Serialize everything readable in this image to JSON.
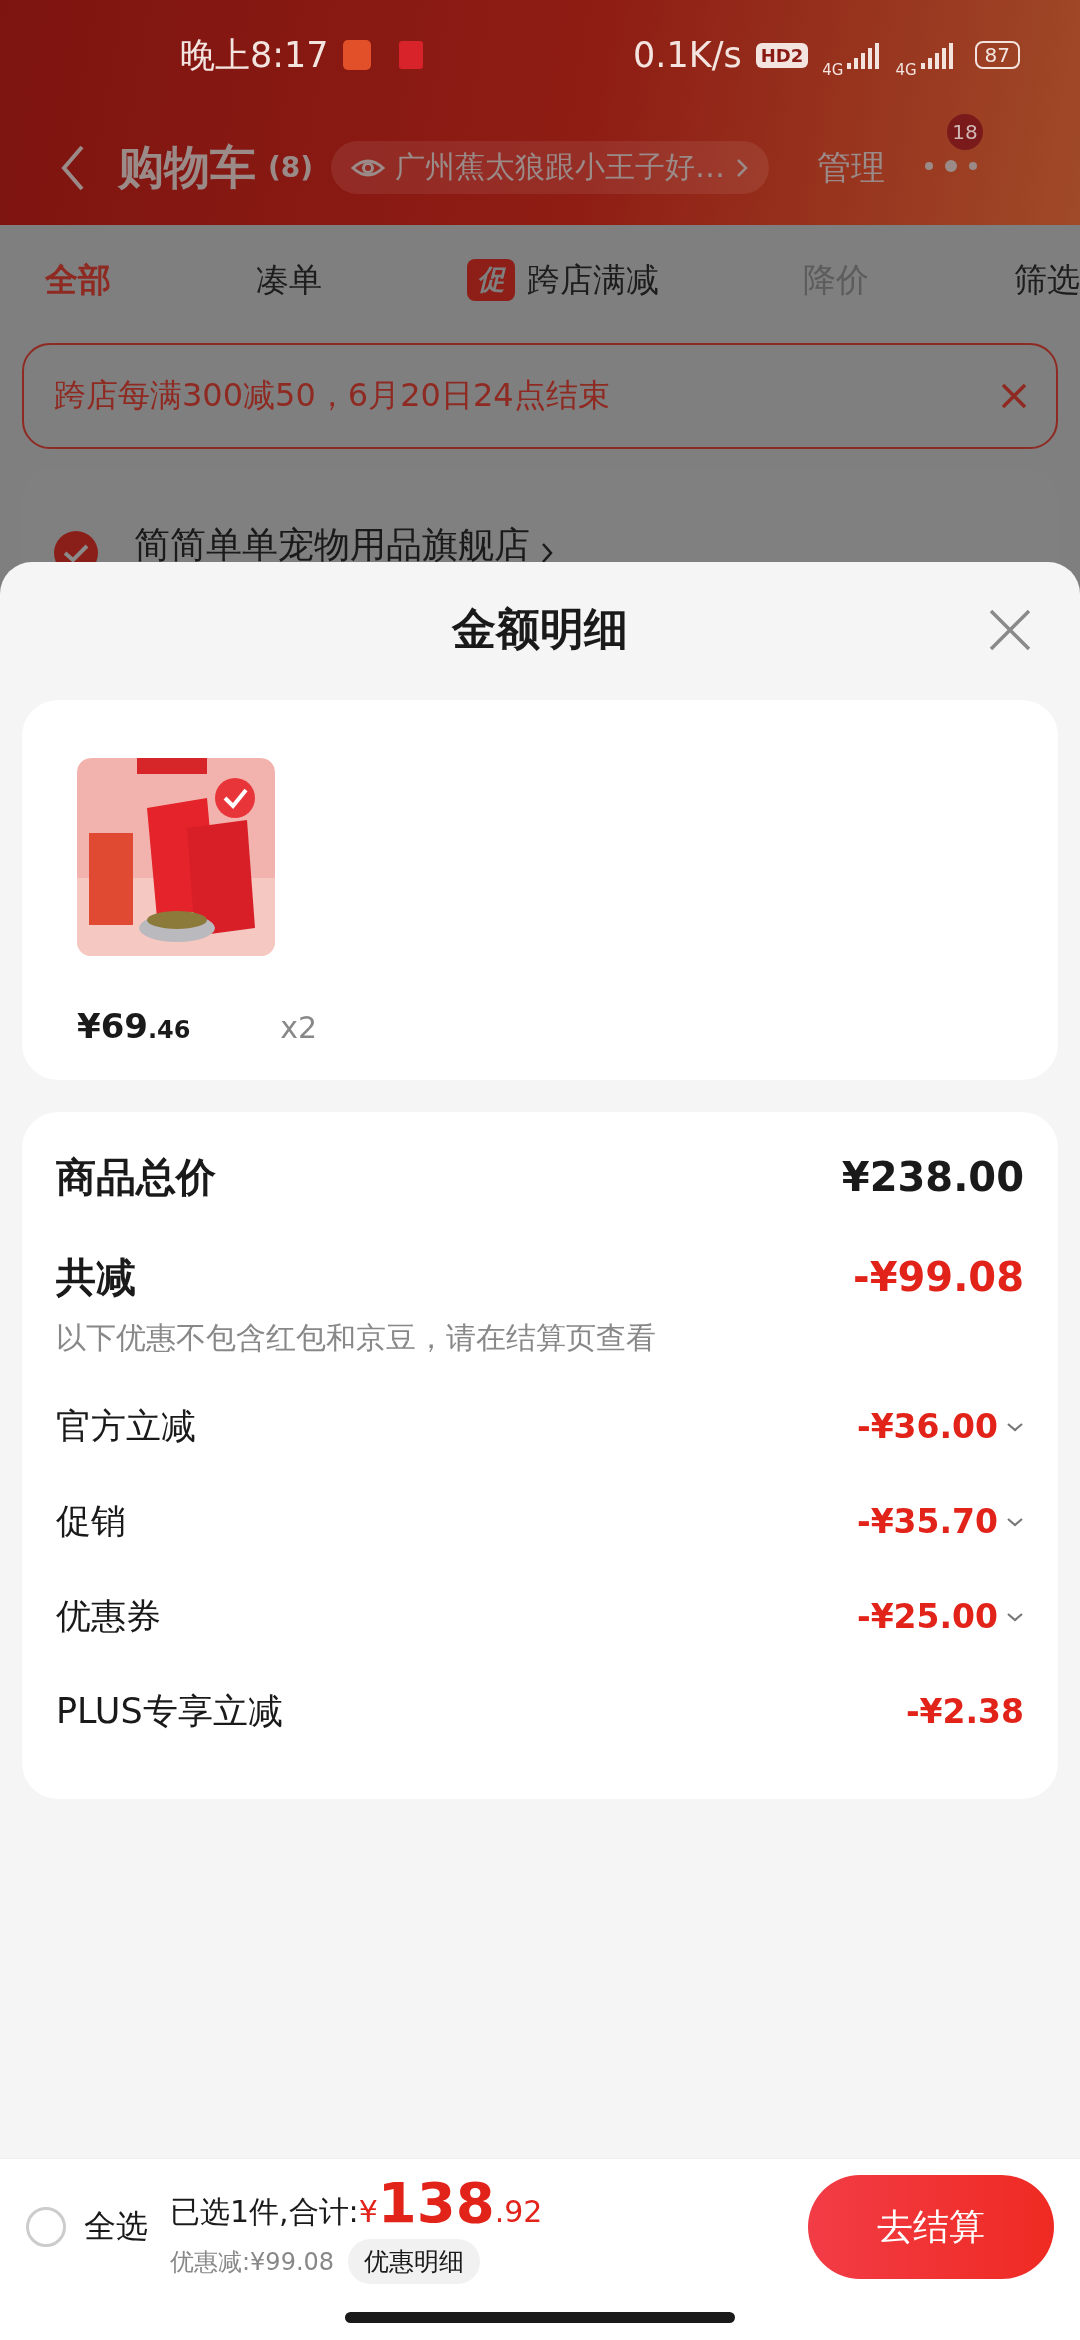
{
  "status_bar": {
    "time": "晚上8:17",
    "speed": "0.1K/s",
    "hd": "HD2",
    "networks": [
      "4G",
      "4G"
    ],
    "battery": "87"
  },
  "header": {
    "title": "购物车",
    "count": "(8)",
    "location": "广州蕉太狼跟小王子好…",
    "manage": "管理",
    "badge": "18"
  },
  "tabs": [
    {
      "label": "全部",
      "selected": true,
      "disabled": false,
      "kind": "text"
    },
    {
      "label": "凑单",
      "selected": false,
      "disabled": false,
      "kind": "text"
    },
    {
      "label": "跨店满减",
      "selected": false,
      "disabled": false,
      "kind": "promo",
      "tag": "促"
    },
    {
      "label": "降价",
      "selected": false,
      "disabled": true,
      "kind": "text"
    },
    {
      "label": "筛选",
      "selected": false,
      "disabled": false,
      "kind": "text"
    }
  ],
  "banner": {
    "text": "跨店每满300减50，6月20日24点结束"
  },
  "store": {
    "name": "简简单单宠物用品旗舰店",
    "checked": true
  },
  "sheet": {
    "title": "金额明细",
    "items": [
      {
        "kind": "picture",
        "price_main": "¥69",
        "price_decimal": ".46",
        "qty": "x2"
      }
    ],
    "total": {
      "label": "商品总价",
      "value": "¥238.00"
    },
    "discount": {
      "label": "共减",
      "value": "-¥99.08",
      "note": "以下优惠不包含红包和京豆，请在结算页查看"
    },
    "lines": [
      {
        "label": "官方立减",
        "value": "-¥36.00",
        "expandable": true
      },
      {
        "label": "促销",
        "value": "-¥35.70",
        "expandable": true
      },
      {
        "label": "优惠券",
        "value": "-¥25.00",
        "expandable": true
      },
      {
        "label": "PLUS专享立减",
        "value": "-¥2.38",
        "expandable": false
      }
    ]
  },
  "footer": {
    "select_all": {
      "label": "全选",
      "checked": false
    },
    "selected_text": "已选1件,合计:",
    "currency": "¥",
    "total_main": "138",
    "total_decimal": ".92",
    "saved": "优惠减:¥99.08",
    "detail_button": "优惠明细",
    "checkout": "去结算"
  }
}
